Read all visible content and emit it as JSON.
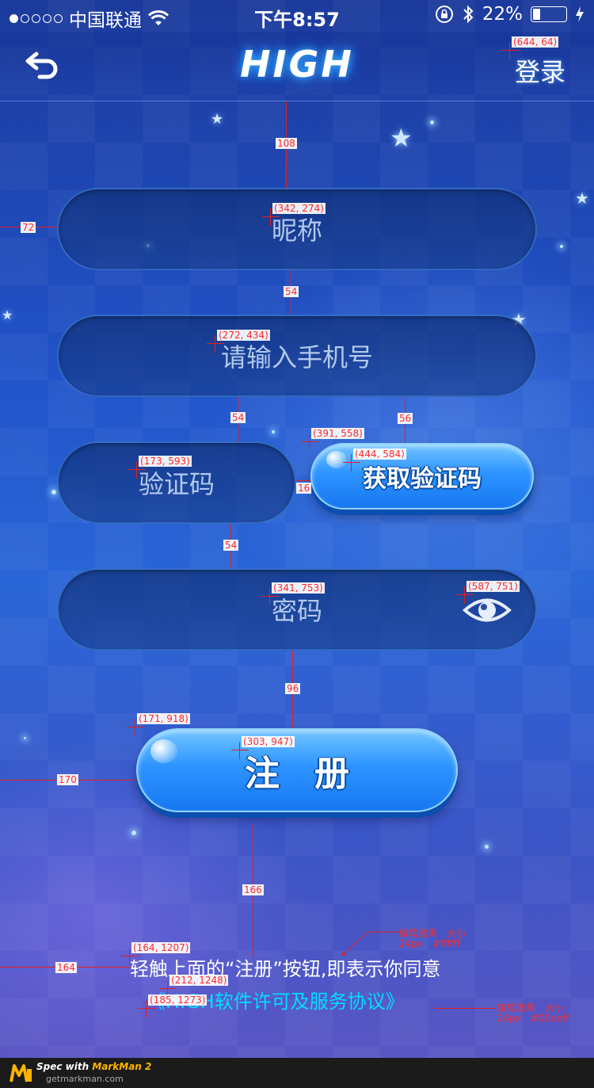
{
  "status_bar": {
    "carrier": "中国联通",
    "time": "下午8:57",
    "battery": "22%",
    "battery_level": 0.22
  },
  "nav": {
    "title": "HIGH",
    "login_label": "登录"
  },
  "form": {
    "nickname_placeholder": "昵称",
    "phone_placeholder": "请输入手机号",
    "code_placeholder": "验证码",
    "get_code_label": "获取验证码",
    "password_placeholder": "密码",
    "register_label": "注　册"
  },
  "footer": {
    "agreement_text": "轻触上面的“注册”按钮,即表示你同意",
    "license_link": "《HIGH软件许可及服务协议》"
  },
  "colors": {
    "agreement_text": "#ffffff",
    "license_link": "#00deff",
    "button_blue": "#2d94ff"
  },
  "annotations": {
    "login_coord": "(644, 64)",
    "gap_nav_nickname": "108",
    "nickname_coord": "(342, 274)",
    "left_margin_input": "72",
    "gap_nickname_phone": "54",
    "phone_coord": "(272, 434)",
    "gap_phone_code": "54",
    "gap_phone_button": "56",
    "button_coord": "(391, 558)",
    "button_text_coord": "(444, 584)",
    "code_coord": "(173, 593)",
    "gap_code_button": "16",
    "gap_code_password": "54",
    "password_coord": "(341, 753)",
    "eye_coord": "(587, 751)",
    "gap_password_register": "96",
    "register_coord": "(171, 918)",
    "register_text_coord": "(303, 947)",
    "left_margin_register": "170",
    "gap_register_footer": "166",
    "agreement_coord": "(164, 1207)",
    "left_margin_footer": "164",
    "license_coord_a": "(212, 1248)",
    "license_coord_b": "(185, 1273)",
    "font_note_1_a": "微软雅黑　大小",
    "font_note_1_b": "24px　#ffffff",
    "font_note_2_a": "微软雅黑　大小",
    "font_note_2_b": "24px　#00deff"
  },
  "markman": {
    "spec_with": "Spec with ",
    "brand": "MarkMan 2",
    "site": "getmarkman.com"
  }
}
